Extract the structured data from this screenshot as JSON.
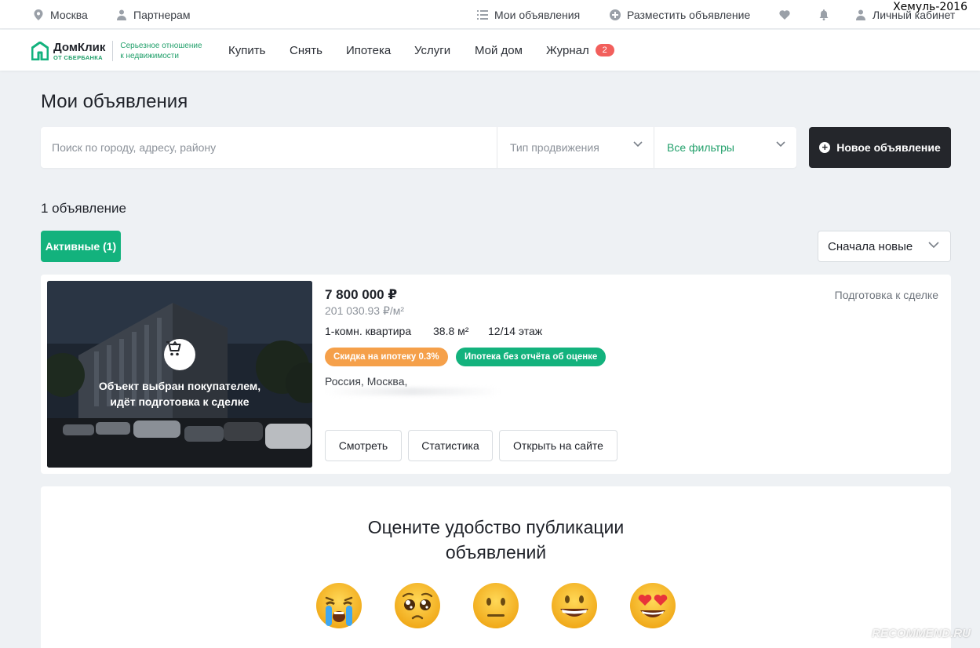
{
  "topbar": {
    "city": "Москва",
    "partners": "Партнерам",
    "my_ads": "Мои объявления",
    "place_ad": "Разместить объявление",
    "account": "Личный кабинет"
  },
  "watermark_user": "Хемуль-2016",
  "logo": {
    "name": "ДомКлик",
    "sub": "ОТ СБЕРБАНКА",
    "tagline_1": "Серьезное отношение",
    "tagline_2": "к недвижимости"
  },
  "nav": {
    "items": [
      "Купить",
      "Снять",
      "Ипотека",
      "Услуги",
      "Мой дом",
      "Журнал"
    ],
    "journal_badge": "2"
  },
  "page": {
    "title": "Мои объявления",
    "search_placeholder": "Поиск по городу, адресу, району",
    "promo_type": "Тип продвижения",
    "all_filters": "Все фильтры",
    "new_ad": "Новое объявление",
    "count": "1 объявление",
    "tab_active": "Активные (1)",
    "sort": "Сначала новые"
  },
  "listing": {
    "overlay_line1": "Объект выбран покупателем,",
    "overlay_line2": "идёт подготовка к сделке",
    "price": "7 800 000 ₽",
    "price_per_m2": "201 030.93 ₽/м²",
    "rooms": "1-комн. квартира",
    "area": "38.8 м²",
    "floor": "12/14 этаж",
    "chip_discount": "Скидка на ипотеку 0.3%",
    "chip_no_report": "Ипотека без отчёта об оценке",
    "address": "Россия, Москва,",
    "status": "Подготовка к сделке",
    "btn_view": "Смотреть",
    "btn_stats": "Статистика",
    "btn_open": "Открыть на сайте"
  },
  "rating": {
    "title_1": "Оцените удобство публикации",
    "title_2": "объявлений"
  },
  "colors": {
    "brand_green": "#13b27d",
    "dark_button": "#24262b",
    "badge_red": "#f25f5c",
    "chip_orange": "#f5a04a",
    "chip_green": "#13b27d"
  },
  "site_watermark": "RECOMMEND.RU"
}
